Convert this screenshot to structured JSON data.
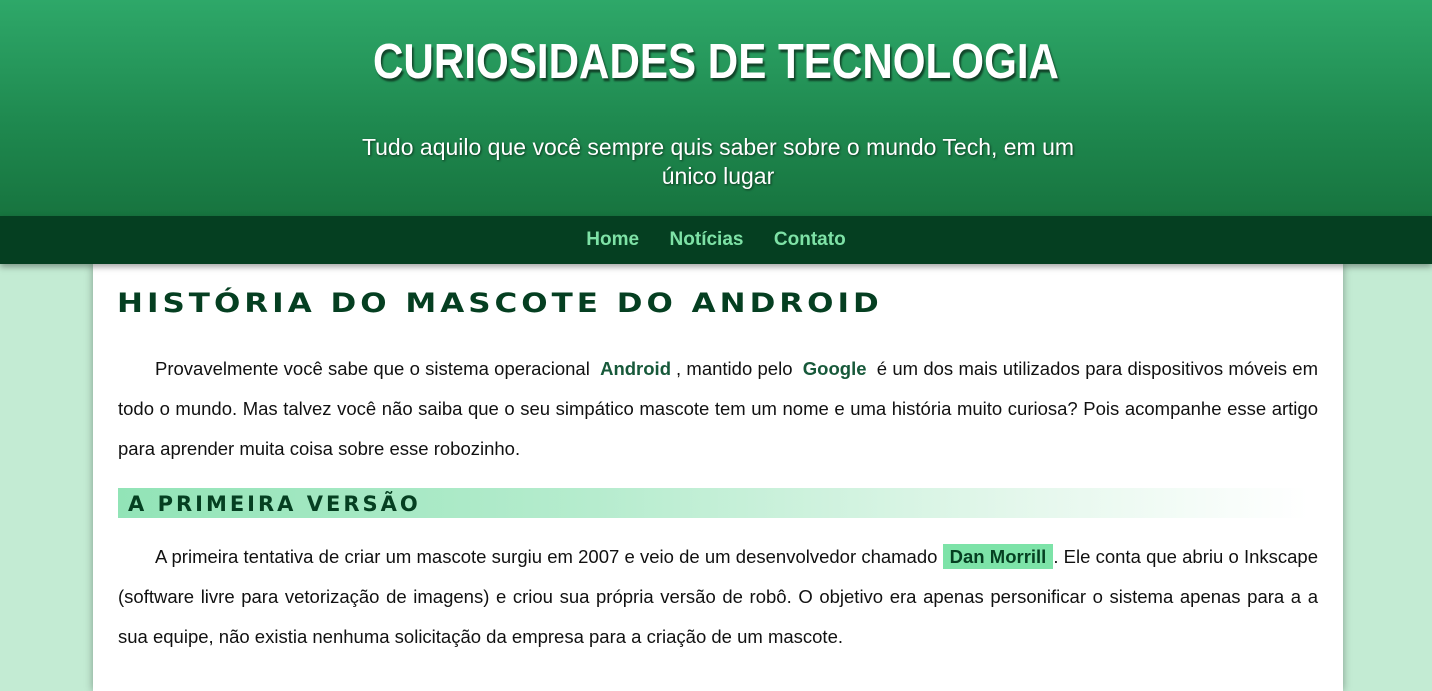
{
  "header": {
    "title": "Curiosidades de Tecnologia",
    "subtitle": "Tudo aquilo que você sempre quis saber sobre o mundo Tech, em um único lugar"
  },
  "nav": {
    "items": [
      {
        "label": "Home"
      },
      {
        "label": "Notícias"
      },
      {
        "label": "Contato"
      }
    ]
  },
  "article": {
    "title": "História do Mascote do Android",
    "intro": {
      "t1": "Provavelmente você sabe que o sistema operacional",
      "kw1": "Android",
      "t2": ", mantido pelo",
      "kw2": "Google",
      "t3": "é um dos mais utilizados para dispositivos móveis em todo o mundo. Mas talvez você não saiba que o seu simpático mascote tem um nome e uma história muito curiosa? Pois acompanhe esse artigo para aprender muita coisa sobre esse robozinho."
    },
    "section1": {
      "heading": "A primeira versão",
      "t1": "A primeira tentativa de criar um mascote surgiu em 2007 e veio de um desenvolvedor chamado",
      "kw1": "Dan Morrill",
      "t2": ". Ele conta que abriu o Inkscape (software livre para vetorização de imagens) e criou sua própria versão de robô. O objetivo era apenas personificar o sistema apenas para a a sua equipe, não existia nenhuma solicitação da empresa para a criação de um mascote."
    }
  },
  "colors": {
    "header_top": "#2ea869",
    "header_bottom": "#17743f",
    "nav_bg": "#053f21",
    "nav_link": "#7ee2a6",
    "page_bg": "#c3ebd3",
    "heading": "#053f21",
    "highlight": "#7de3a8"
  }
}
